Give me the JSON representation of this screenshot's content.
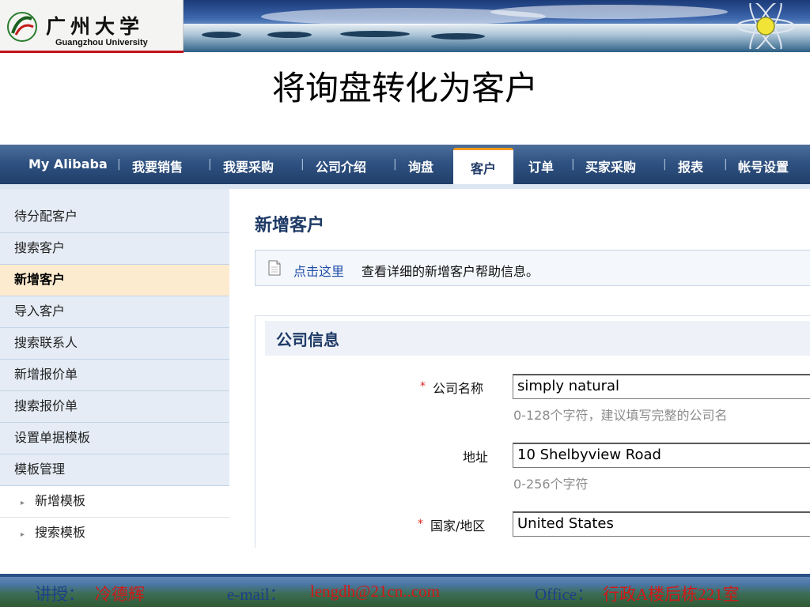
{
  "header": {
    "logo_cn": "广州大学",
    "logo_en": "Guangzhou University"
  },
  "slide_title": "将询盘转化为客户",
  "nav": {
    "items": [
      "My Alibaba",
      "我要销售",
      "我要采购",
      "公司介绍",
      "询盘",
      "客户",
      "订单",
      "买家采购",
      "报表",
      "帐号设置"
    ],
    "active": "客户"
  },
  "sidebar": {
    "items": [
      "待分配客户",
      "搜索客户",
      "新增客户",
      "导入客户",
      "搜索联系人",
      "新增报价单",
      "搜索报价单",
      "设置单据模板",
      "模板管理"
    ],
    "active": "新增客户",
    "sub_items": [
      "新增模板",
      "搜索模板"
    ]
  },
  "main": {
    "title": "新增客户",
    "help_link": "点击这里",
    "help_text": "查看详细的新增客户帮助信息。",
    "section_title": "公司信息",
    "fields": [
      {
        "label": "公司名称",
        "required": true,
        "value": "simply natural",
        "hint": "0-128个字符，建议填写完整的公司名"
      },
      {
        "label": "地址",
        "required": false,
        "value": "10 Shelbyview Road",
        "hint": "0-256个字符"
      },
      {
        "label": "国家/地区",
        "required": true,
        "value": "United States",
        "hint": ""
      }
    ],
    "required_mark": "*"
  },
  "footer": {
    "lecturer_label": "讲授：",
    "lecturer_name": "冷德辉",
    "email_label": "e-mail：",
    "email": "lengdh@21cn..com",
    "office_label": "Office：",
    "office": "行政A楼后栋221室"
  },
  "colors": {
    "nav_bg": "#2f5282",
    "active_tab_border": "#f09b1b",
    "sidebar_bg": "#e5ecf5",
    "sidebar_active": "#fdebd0",
    "link": "#1f4ea8",
    "required": "#e0241b",
    "footer_label": "#1d3f8a",
    "footer_value": "#d01818"
  }
}
